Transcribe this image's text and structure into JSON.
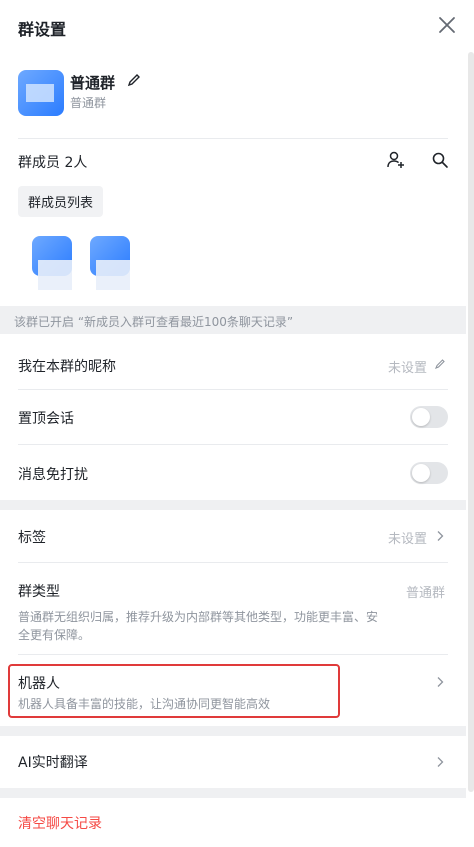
{
  "header": {
    "title": "群设置"
  },
  "profile": {
    "name": "普通群",
    "subtitle": "普通群"
  },
  "members": {
    "title": "群成员 2人",
    "list_button": "群成员列表"
  },
  "notice": "该群已开启 “新成员入群可查看最近100条聊天记录”",
  "settings": {
    "nickname": {
      "label": "我在本群的昵称",
      "value": "未设置"
    },
    "pin": {
      "label": "置顶会话"
    },
    "mute": {
      "label": "消息免打扰"
    },
    "tags": {
      "label": "标签",
      "value": "未设置"
    },
    "group_type": {
      "label": "群类型",
      "value": "普通群",
      "desc_line1": "普通群无组织归属，推荐升级为内部群等其他类型，功能更丰富、安",
      "desc_line2": "全更有保障。"
    },
    "robot": {
      "label": "机器人",
      "desc": "机器人具备丰富的技能，让沟通协同更智能高效"
    },
    "ai_translate": {
      "label": "AI实时翻译"
    }
  },
  "footer": {
    "clear_history": "清空聊天记录"
  },
  "colors": {
    "accent_red": "#f54a45",
    "highlight_red": "#e03a3a",
    "toggle_off": "#e3e5e8",
    "avatar_blue": "#2b7cff"
  }
}
